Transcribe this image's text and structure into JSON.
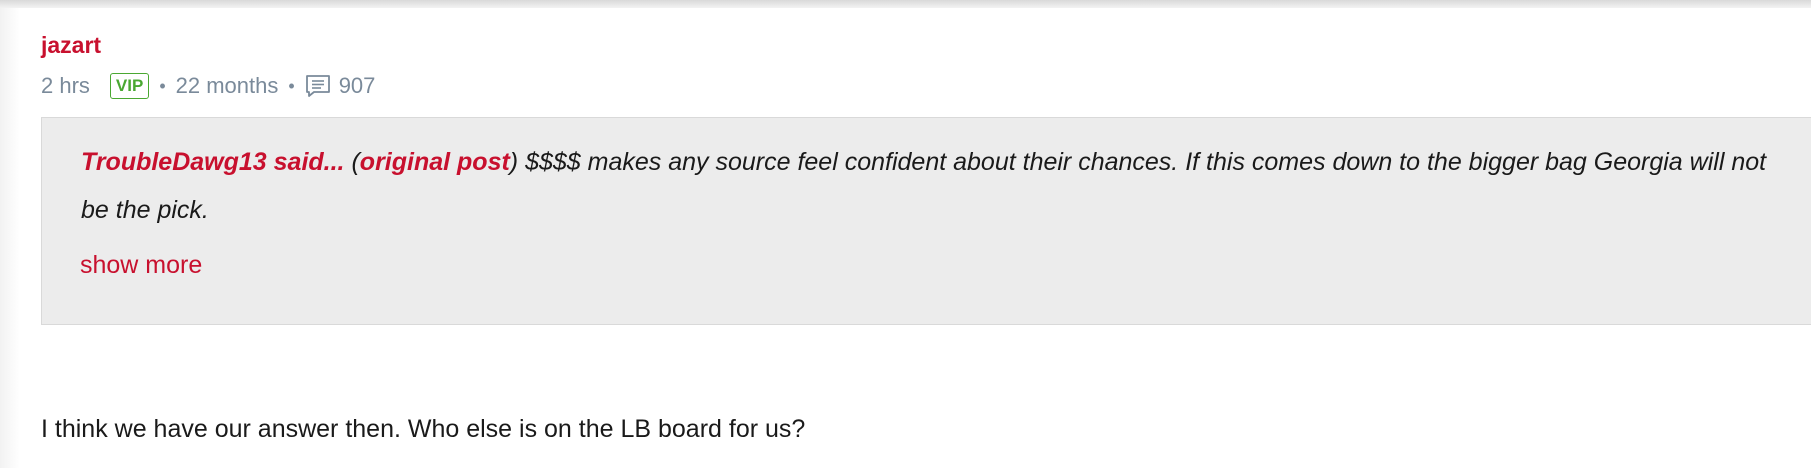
{
  "post": {
    "username": "jazart",
    "time_ago": "2 hrs",
    "badge": "VIP",
    "member_duration": "22 months",
    "post_count": "907",
    "separator": "•",
    "quote": {
      "author_label": "TroubleDawg13 said...",
      "open_paren": " (",
      "original_post_link": "original post",
      "close_paren": ")",
      "text": " $$$$ makes any source feel confident about their chances. If this comes down to the bigger bag Georgia will not be the pick.",
      "show_more": "show more"
    },
    "body": "I think we have our answer then. Who else is on the LB board for us?"
  },
  "colors": {
    "accent": "#c8102e",
    "vip": "#4aa832",
    "meta": "#7a8a9a",
    "quote_bg": "#ececec"
  },
  "icons": {
    "posts": "comment-list-icon"
  }
}
